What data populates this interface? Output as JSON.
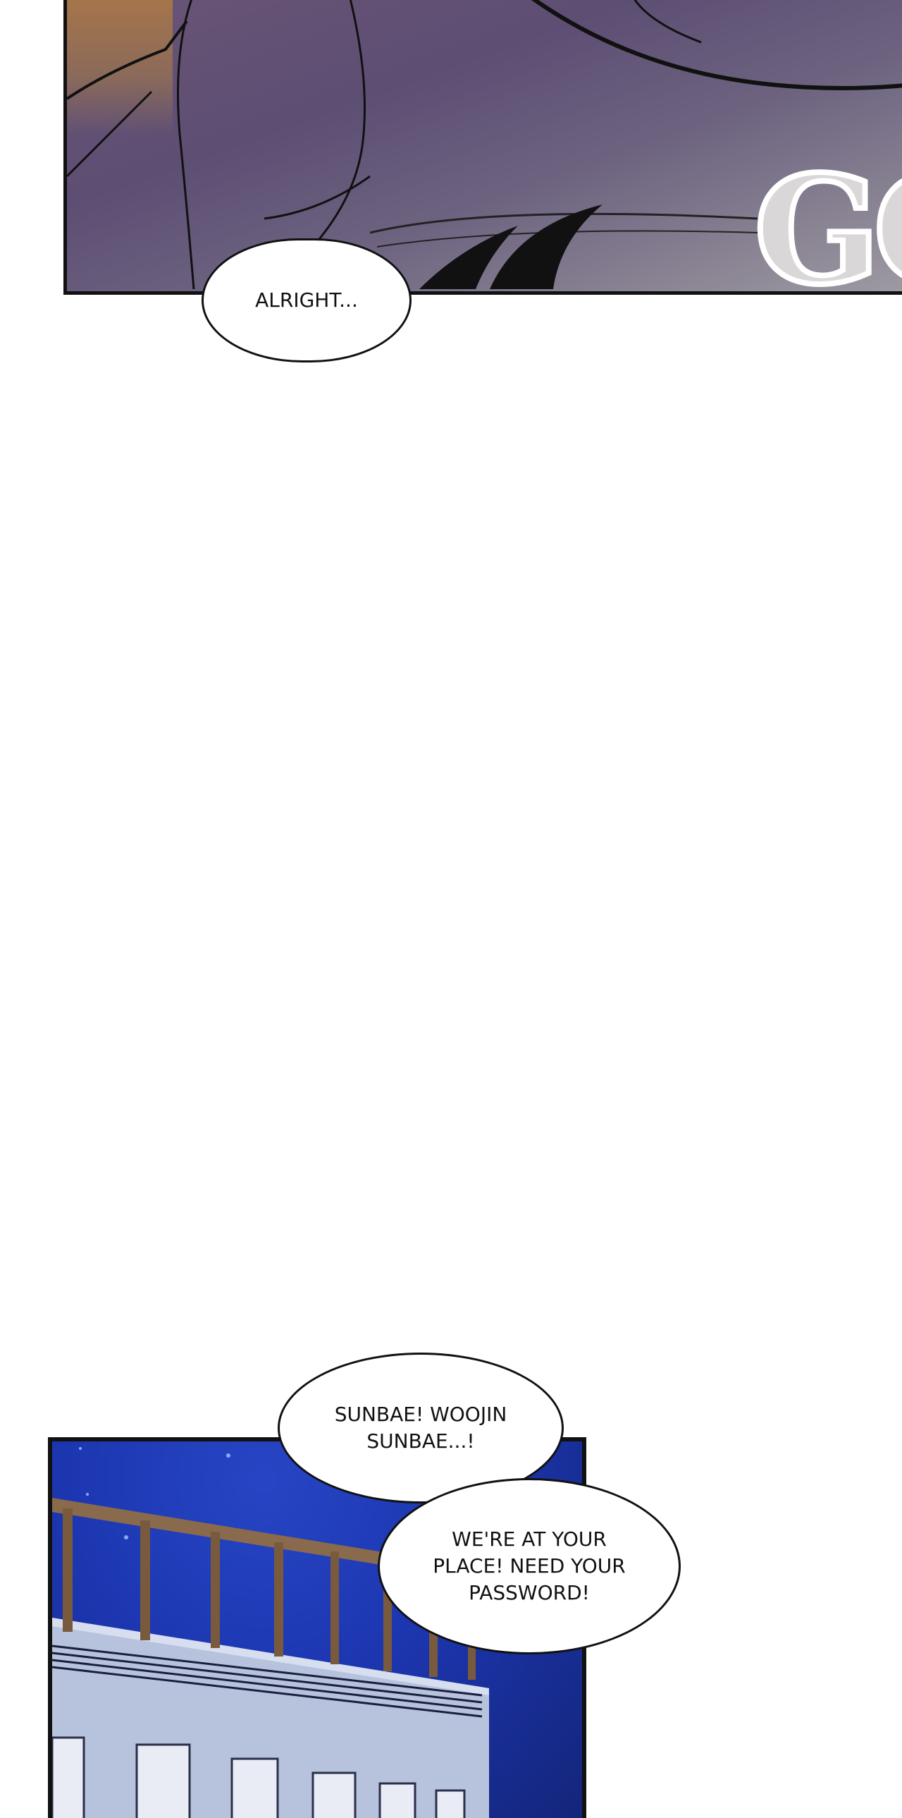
{
  "panels": {
    "top": {
      "description_colors": {
        "shirt": "#5d4e73",
        "background": "#9e9aa3",
        "ink": "#111111"
      },
      "sound_effect": "GO"
    },
    "bottom": {
      "description_colors": {
        "sky": "#1c36b0",
        "building": "#b7c3dd",
        "railing": "#7a5a3c"
      }
    }
  },
  "bubbles": {
    "alright": "ALRIGHT...",
    "sunbae": "SUNBAE! WOOJIN\nSUNBAE...!",
    "password": "WE'RE AT YOUR\nPLACE! NEED YOUR\nPASSWORD!"
  }
}
